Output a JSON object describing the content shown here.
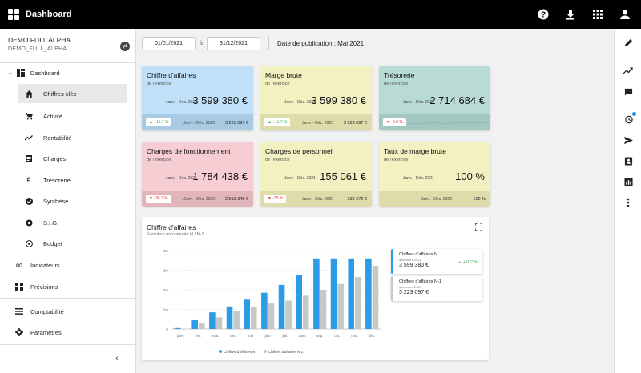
{
  "header": {
    "title": "Dashboard"
  },
  "sidebar": {
    "company": "DEMO FULL ALPHA",
    "company_code": "DEMO_FULL_ALPHA",
    "dashboard_label": "Dashboard",
    "items": [
      {
        "label": "Chiffres clés"
      },
      {
        "label": "Activité"
      },
      {
        "label": "Rentabilité"
      },
      {
        "label": "Charges"
      },
      {
        "label": "Trésorerie"
      },
      {
        "label": "Synthèse"
      },
      {
        "label": "S.I.G."
      },
      {
        "label": "Budget"
      }
    ],
    "indicateurs": "Indicateurs",
    "previsions": "Prévisions",
    "comptabilite": "Comptabilité",
    "parametres": "Paramètres"
  },
  "filters": {
    "date_from": "01/01/2021",
    "separator": "à",
    "date_to": "31/12/2021",
    "publication": "Date de publication : Mai 2021"
  },
  "cards": [
    {
      "title": "Chiffre d'affaires",
      "subtitle": "de l'exercice",
      "period": "Janv. - Déc. 2021",
      "value": "3 599 380 €",
      "badge": "▲ +11.7 %",
      "prev_period": "Janv. - Déc. 2020",
      "prev_value": "3 223 097 €",
      "bg": "#bfe0f8",
      "foot": "#a8cbe3",
      "trend": "up"
    },
    {
      "title": "Marge brute",
      "subtitle": "de l'exercice",
      "period": "Janv. - Déc. 2021",
      "value": "3 599 380 €",
      "badge": "▲ +11.7 %",
      "prev_period": "Janv. - Déc. 2020",
      "prev_value": "3 223 097 €",
      "bg": "#f3f1c2",
      "foot": "#dedcab",
      "trend": "up"
    },
    {
      "title": "Trésorerie",
      "subtitle": "de l'exercice",
      "period": "Janv. - Déc. 2021",
      "value": "2 714 684 €",
      "badge": "▼ -9.9 %",
      "prev_period": "",
      "prev_value": "",
      "bg": "#b8dbd6",
      "foot": "#a3c8c2",
      "trend": "down"
    },
    {
      "title": "Charges de fonctionnement",
      "subtitle": "de l'exercice",
      "period": "Janv. - Déc. 2021",
      "value": "1 784 438 €",
      "badge": "▼ -38.7 %",
      "prev_period": "Janv. - Déc. 2020",
      "prev_value": "2 913 345 €",
      "bg": "#f5cdd2",
      "foot": "#e2b5bb",
      "trend": "down"
    },
    {
      "title": "Charges de personnel",
      "subtitle": "de l'exercice",
      "period": "Janv. - Déc. 2021",
      "value": "155 061 €",
      "badge": "▼ -35 %",
      "prev_period": "Janv. - Déc. 2020",
      "prev_value": "238 672 €",
      "bg": "#f3f1c2",
      "foot": "#dedcab",
      "trend": "down"
    },
    {
      "title": "Taux de marge brute",
      "subtitle": "de l'exercice",
      "period": "Janv. - Déc. 2021",
      "value": "100 %",
      "badge": "",
      "prev_period": "Janv. - Déc. 2020",
      "prev_value": "100 %",
      "bg": "#f3f1c2",
      "foot": "#dedcab",
      "trend": "none"
    }
  ],
  "chart_panel": {
    "title": "Chiffre d'affaires",
    "subtitle": "Évolution en cumulée N / N-1",
    "legend_cards": [
      {
        "name": "Chiffres d'affaires N",
        "period": "décembre 2021",
        "value": "3 599 380 €",
        "badge": "▲ +11.7 %"
      },
      {
        "name": "Chiffres d'affaires N-1",
        "period": "décembre 2020",
        "value": "3 223 097 €",
        "badge": ""
      }
    ]
  },
  "chart_data": {
    "type": "bar",
    "categories": [
      "janv.",
      "fév.",
      "mar.",
      "avr.",
      "mai",
      "juin",
      "juil.",
      "aoû.",
      "sep.",
      "oct.",
      "nov.",
      "déc."
    ],
    "series": [
      {
        "name": "Chiffres d'affaires N",
        "color": "#2e9be6",
        "values": [
          0.05,
          0.45,
          0.85,
          1.15,
          1.5,
          1.85,
          2.25,
          2.75,
          3.6,
          3.6,
          3.6,
          3.6
        ]
      },
      {
        "name": "Chiffres d'affaires N-1",
        "color": "#c8c8c8",
        "values": [
          0.02,
          0.3,
          0.6,
          0.9,
          1.1,
          1.3,
          1.45,
          1.7,
          2.0,
          2.3,
          2.65,
          3.22
        ]
      }
    ],
    "y_ticks": [
      "0",
      "1m",
      "2m",
      "3m",
      "4m"
    ],
    "ylim": [
      0,
      4
    ],
    "grid": true,
    "legend": "bottom"
  },
  "colors": {
    "accent": "#2e9be6",
    "secondary": "#c8c8c8",
    "topbar": "#000000"
  }
}
